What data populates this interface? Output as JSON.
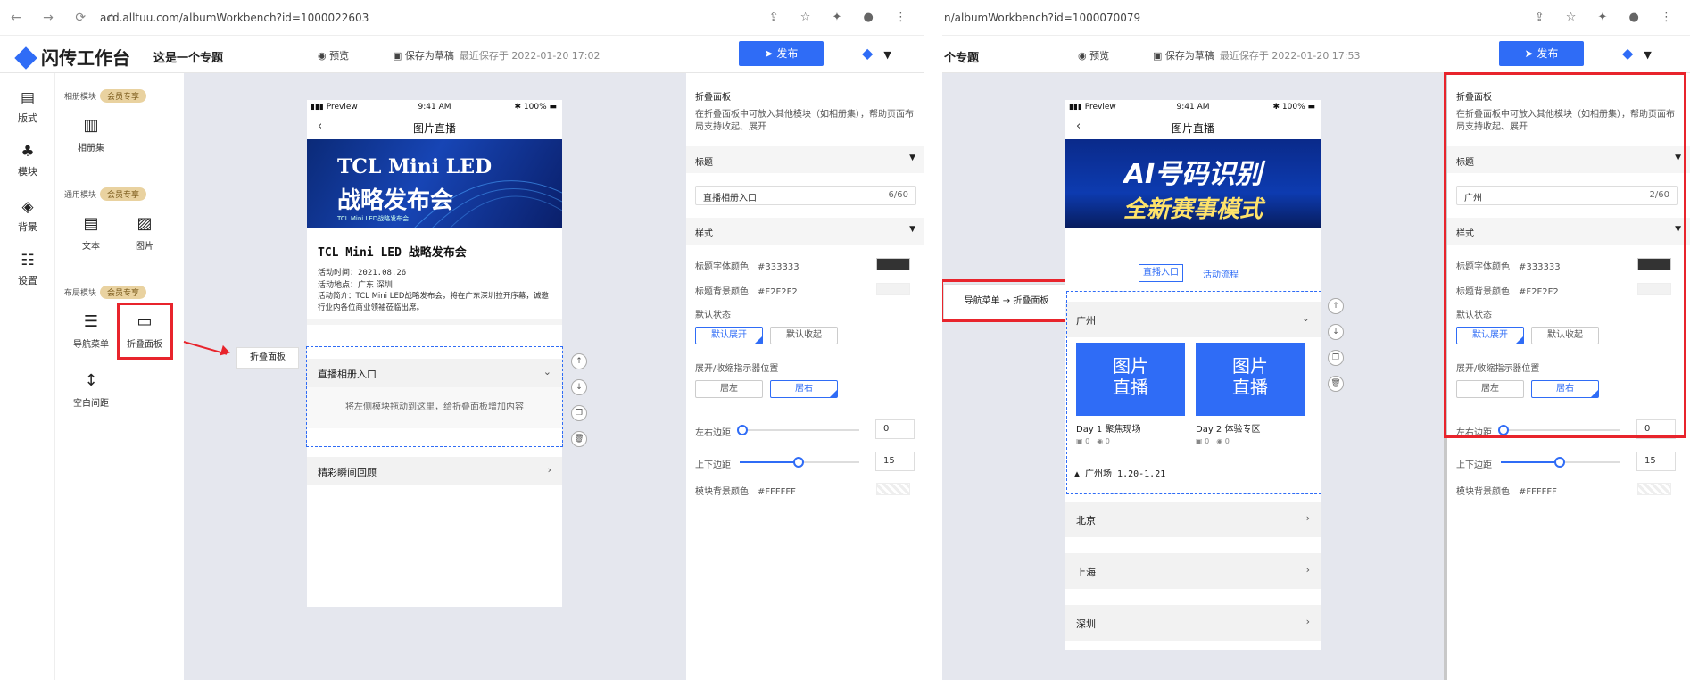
{
  "left": {
    "url": "acd.alltuu.com/albumWorkbench?id=1000022603",
    "logo": "闪传工作台",
    "topic": "这是一个专题",
    "preview": "预览",
    "save": "保存为草稿",
    "saved_time": "最近保存于 2022-01-20 17:02",
    "publish": "发布",
    "nav": [
      "版式",
      "模块",
      "背景",
      "设置"
    ],
    "groups": {
      "album": "相册模块",
      "general": "通用模块",
      "layout": "布局模块",
      "vip": "会员专享"
    },
    "modules": {
      "album_set": "相册集",
      "text": "文本",
      "image": "图片",
      "nav_menu": "导航菜单",
      "fold_panel": "折叠面板",
      "blank": "空白间距"
    },
    "callout": "折叠面板",
    "phone": {
      "status_left": "Preview",
      "status_time": "9:41 AM",
      "status_right": "100%",
      "title": "图片直播",
      "banner_line1": "TCL Mini LED",
      "banner_line2": "战略发布会",
      "banner_small": "TCL Mini LED战略发布会",
      "event_title": "TCL Mini LED 战略发布会",
      "event_time": "活动时间：2021.08.26",
      "event_place": "活动地点：广东 深圳",
      "event_desc": "活动简介：TCL Mini LED战略发布会，将在广东深圳拉开序幕，诚邀行业内各位商业领袖莅临出席。",
      "acc1": "直播相册入口",
      "drop_hint": "将左侧模块拖动到这里，给折叠面板增加内容",
      "acc2": "精彩瞬间回顾"
    },
    "props": {
      "title": "折叠面板",
      "desc": "在折叠面板中可放入其他模块（如相册集），帮助页面布局支持收起、展开",
      "sec_title": "标题",
      "title_value": "直播相册入口",
      "title_count": "6/60",
      "sec_style": "样式",
      "font_color_lbl": "标题字体颜色",
      "font_color": "#333333",
      "bg_color_lbl": "标题背景颜色",
      "bg_color": "#F2F2F2",
      "default_state": "默认状态",
      "expand": "默认展开",
      "collapse": "默认收起",
      "indicator": "展开/收缩指示器位置",
      "left": "居左",
      "right": "居右",
      "lr_margin": "左右边距",
      "lr_value": "0",
      "tb_margin": "上下边距",
      "tb_value": "15",
      "module_bg_lbl": "模块背景颜色",
      "module_bg": "#FFFFFF"
    }
  },
  "right": {
    "url": "n/albumWorkbench?id=1000070079",
    "topic": "个专题",
    "preview": "预览",
    "save": "保存为草稿",
    "saved_time": "最近保存于 2022-01-20 17:53",
    "publish": "发布",
    "callout": "导航菜单 → 折叠面板",
    "phone": {
      "status_left": "Preview",
      "status_time": "9:41 AM",
      "status_right": "100%",
      "title": "图片直播",
      "banner_line1": "AI号码识别",
      "banner_line2": "全新赛事模式",
      "tab1": "直播入口",
      "tab2": "活动流程",
      "acc_gz": "广州",
      "tile_text1": "图片",
      "tile_text2": "直播",
      "day1": "Day 1 聚焦现场",
      "day2": "Day 2 体验专区",
      "zero": "0",
      "gz_venue": "▲ 广州场 1.20-1.21",
      "acc_bj": "北京",
      "acc_sh": "上海",
      "acc_sz": "深圳"
    },
    "props": {
      "title": "折叠面板",
      "desc": "在折叠面板中可放入其他模块（如相册集），帮助页面布局支持收起、展开",
      "sec_title": "标题",
      "title_value": "广州",
      "title_count": "2/60",
      "sec_style": "样式",
      "font_color_lbl": "标题字体颜色",
      "font_color": "#333333",
      "bg_color_lbl": "标题背景颜色",
      "bg_color": "#F2F2F2",
      "default_state": "默认状态",
      "expand": "默认展开",
      "collapse": "默认收起",
      "indicator": "展开/收缩指示器位置",
      "left": "居左",
      "right": "居右",
      "lr_margin": "左右边距",
      "lr_value": "0",
      "tb_margin": "上下边距",
      "tb_value": "15",
      "module_bg_lbl": "模块背景颜色",
      "module_bg": "#FFFFFF"
    }
  },
  "colors": {
    "accent": "#2f6cf6",
    "highlight": "#e8242c"
  }
}
